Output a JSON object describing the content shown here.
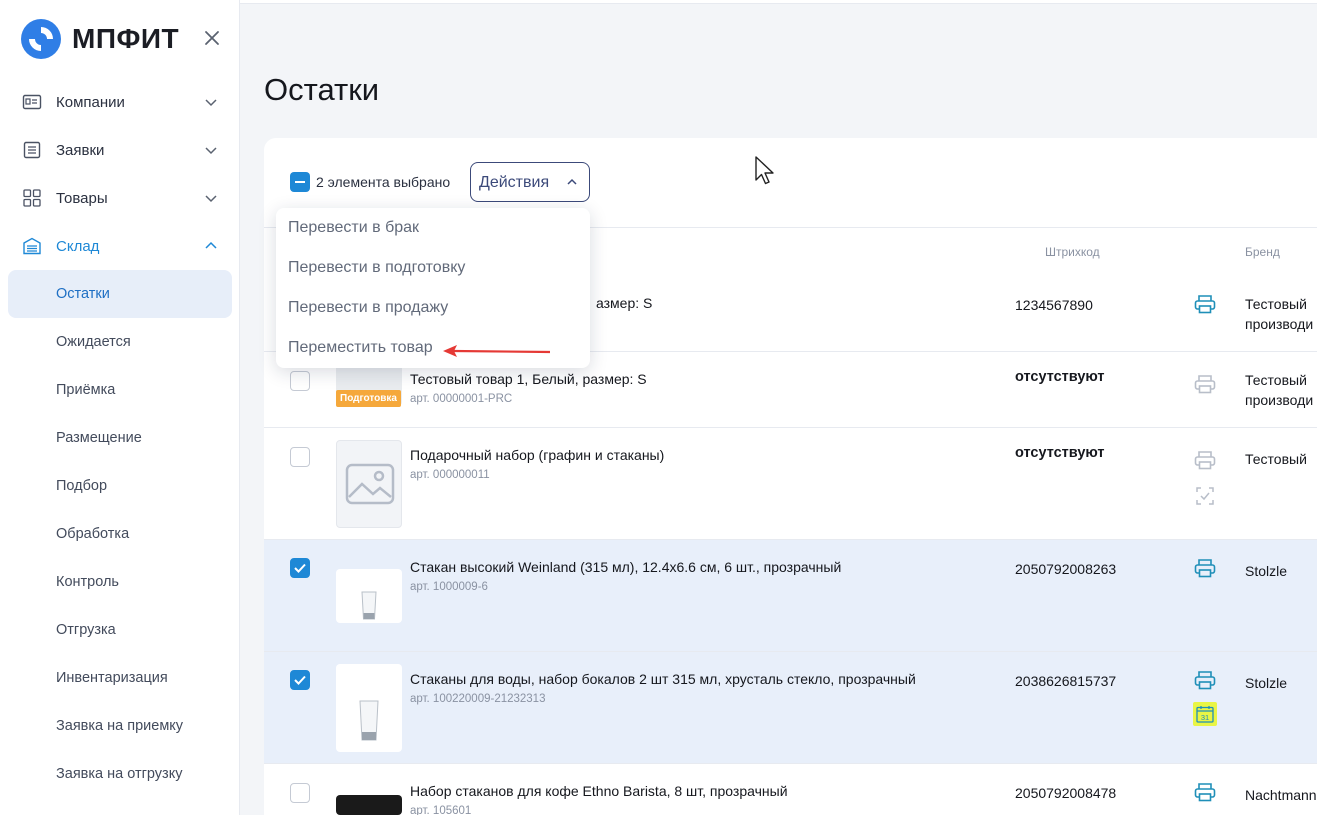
{
  "app": {
    "brand": "МПФИТ"
  },
  "sidebar": {
    "groups": [
      {
        "label": "Компании",
        "icon": "contacts-card-icon",
        "expanded": false
      },
      {
        "label": "Заявки",
        "icon": "list-icon",
        "expanded": false
      },
      {
        "label": "Товары",
        "icon": "grid-icon",
        "expanded": false
      },
      {
        "label": "Склад",
        "icon": "warehouse-icon",
        "expanded": true
      }
    ],
    "items": [
      {
        "label": "Остатки",
        "active": true
      },
      {
        "label": "Ожидается"
      },
      {
        "label": "Приёмка"
      },
      {
        "label": "Размещение"
      },
      {
        "label": "Подбор"
      },
      {
        "label": "Обработка"
      },
      {
        "label": "Контроль"
      },
      {
        "label": "Отгрузка"
      },
      {
        "label": "Инвентаризация"
      },
      {
        "label": "Заявка на приемку"
      },
      {
        "label": "Заявка на отгрузку"
      }
    ]
  },
  "page": {
    "title": "Остатки"
  },
  "toolbar": {
    "selected_text": "2 элемента выбрано",
    "actions_label": "Действия",
    "menu": [
      "Перевести в брак",
      "Перевести в подготовку",
      "Перевести в продажу",
      "Переместить товар"
    ]
  },
  "columns": {
    "barcode": "Штрихкод",
    "brand": "Бренд"
  },
  "rows": [
    {
      "name": "Тестовый товар 1, Белый, размер: S",
      "name_visible": "азмер: S",
      "article": "",
      "barcode": "1234567890",
      "brand": "Тестовый производи",
      "checked": false,
      "badge": ""
    },
    {
      "name": "Тестовый товар 1, Белый, размер: S",
      "article": "арт. 00000001-PRC",
      "barcode": "отсутствуют",
      "brand": "Тестовый производи",
      "checked": false,
      "badge": "Подготовка"
    },
    {
      "name": "Подарочный набор (графин и стаканы)",
      "article": "арт. 000000011",
      "barcode": "отсутствуют",
      "brand": "Тестовый",
      "checked": false,
      "badge": ""
    },
    {
      "name": "Стакан высокий Weinland (315 мл), 12.4x6.6 см, 6 шт., прозрачный",
      "article": "арт. 1000009-6",
      "barcode": "2050792008263",
      "brand": "Stolzle",
      "checked": true,
      "badge": ""
    },
    {
      "name": "Стаканы для воды, набор бокалов 2 шт 315 мл, хрусталь стекло, прозрачный",
      "article": "арт. 100220009-21232313",
      "barcode": "2038626815737",
      "brand": "Stolzle",
      "checked": true,
      "badge": ""
    },
    {
      "name": "Набор стаканов для кофе Ethno Barista, 8 шт, прозрачный",
      "article": "арт. 105601",
      "barcode": "2050792008478",
      "brand": "Nachtmann",
      "checked": false,
      "badge": ""
    }
  ],
  "calendar_icon_text": "31",
  "colors": {
    "accent": "#1e88d6",
    "print_active": "#1f8fb8",
    "print_inactive": "#b8bec9",
    "badge": "#f5a83b",
    "highlight": "#e9f545",
    "arrow": "#e53935"
  }
}
